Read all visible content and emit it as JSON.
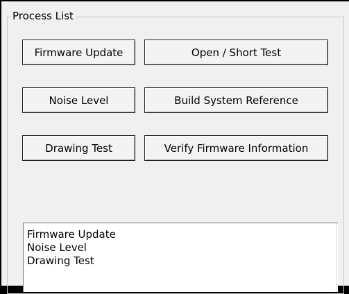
{
  "group": {
    "title": "Process List"
  },
  "buttons": {
    "firmware_update": "Firmware Update",
    "open_short_test": "Open / Short Test",
    "noise_level": "Noise Level",
    "build_system_reference": "Build System Reference",
    "drawing_test": "Drawing Test",
    "verify_firmware_information": "Verify Firmware Information"
  },
  "process_list": {
    "items": [
      "Firmware Update",
      "Noise Level",
      "Drawing Test"
    ]
  }
}
